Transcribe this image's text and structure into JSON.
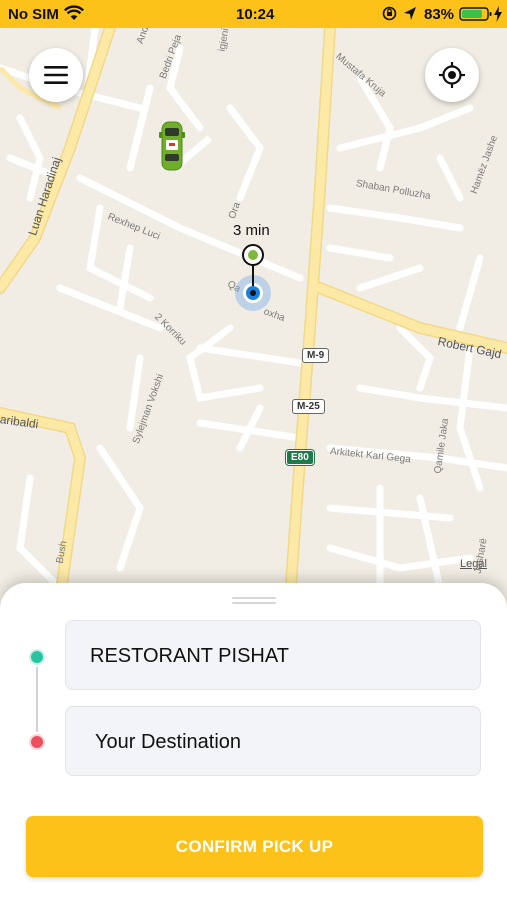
{
  "status_bar": {
    "carrier": "No SIM",
    "time": "10:24",
    "battery_percent": "83%",
    "battery_level": 0.83,
    "icons": [
      "wifi-icon",
      "rotation-lock-icon",
      "location-arrow-icon",
      "battery-icon",
      "charging-bolt-icon"
    ]
  },
  "map": {
    "eta": "3 min",
    "streets": [
      "Andre",
      "Bedri Peja",
      "igjeni",
      "Mustafa Kruja",
      "Luan Haradinaj",
      "Rexhep Luci",
      "Ora",
      "Qa",
      "oxha",
      "Shaban Polluzha",
      "Hamëz Jashe",
      "Robert Gajd",
      "2 Korriku",
      "Sylejman Vokshi",
      "aribaldi",
      "Arkitekt Karl Gega",
      "Qamile Jaka",
      "Bush",
      "Jasharë"
    ],
    "route_badges": [
      "M-9",
      "M-25",
      "E80"
    ],
    "legal_label": "Legal"
  },
  "sheet": {
    "pickup_value": "RESTORANT PISHAT",
    "destination_placeholder": "Your Destination",
    "confirm_label": "CONFIRM PICK UP"
  },
  "colors": {
    "accent_yellow": "#fdc21a",
    "pickup_dot": "#27c3a3",
    "destination_dot": "#ee4d5c",
    "map_background": "#f1ede4",
    "major_road": "#fde9a6"
  }
}
